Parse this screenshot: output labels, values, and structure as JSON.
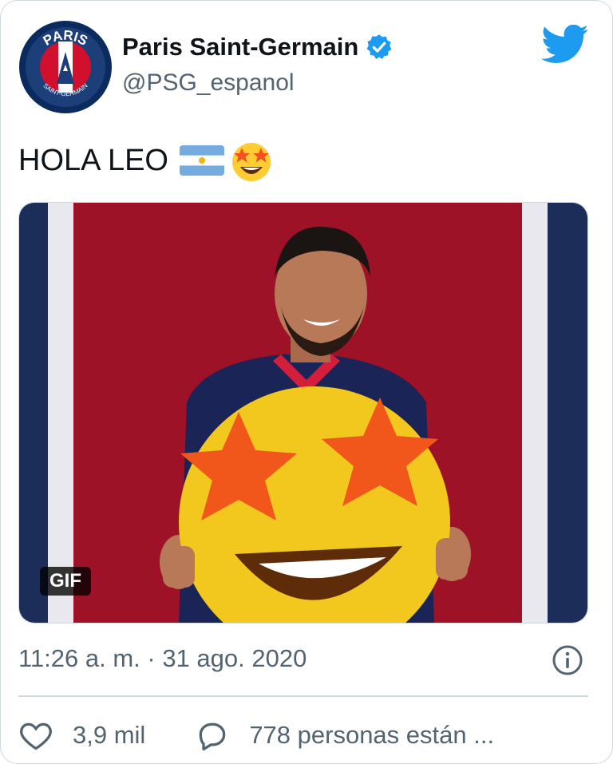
{
  "author": {
    "display_name": "Paris Saint-Germain",
    "handle": "@PSG_espanol",
    "avatar": {
      "top_text": "PARIS",
      "bottom_text": "SAINT-GERMAIN"
    }
  },
  "tweet": {
    "text": "HOLA LEO",
    "emojis": [
      "argentina-flag-icon",
      "star-struck-face-icon"
    ]
  },
  "media": {
    "badge": "GIF"
  },
  "meta": {
    "timestamp": "11:26 a. m. · 31 ago. 2020"
  },
  "actions": {
    "likes": "3,9 mil",
    "replies": "778 personas están ..."
  },
  "colors": {
    "twitter_blue": "#1d9bf0",
    "psg_red": "#c8102e",
    "psg_navy": "#1c2d5a",
    "text_primary": "#0f1419",
    "text_secondary": "#536471"
  },
  "icons": [
    "psg-logo",
    "verified-badge-icon",
    "twitter-bird-icon",
    "info-icon",
    "heart-icon",
    "reply-bubble-icon"
  ]
}
